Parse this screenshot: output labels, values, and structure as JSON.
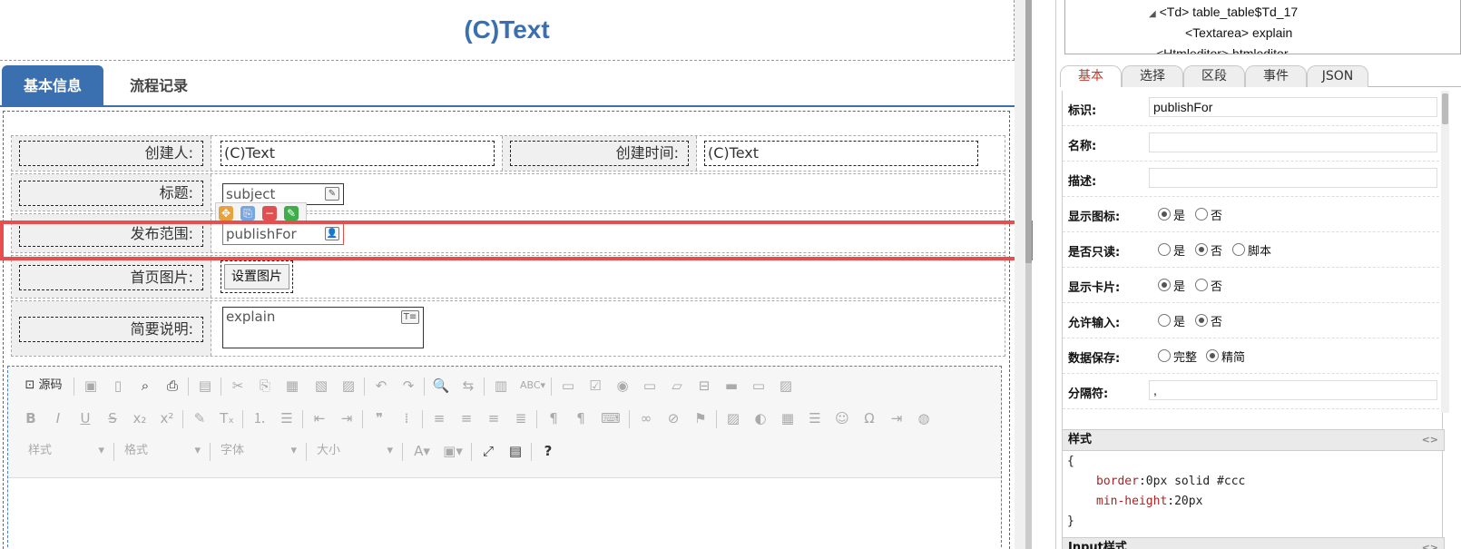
{
  "form": {
    "title": "(C)Text",
    "tabs": [
      {
        "label": "基本信息"
      },
      {
        "label": "流程记录"
      }
    ],
    "fields": {
      "creator_label": "创建人:",
      "creator_value": "(C)Text",
      "created_time_label": "创建时间:",
      "created_time_value": "(C)Text",
      "subject_label": "标题:",
      "subject_value": "subject",
      "publish_label": "发布范围:",
      "publish_value": "publishFor",
      "image_label": "首页图片:",
      "image_button": "设置图片",
      "explain_label": "简要说明:",
      "explain_value": "explain"
    },
    "editor": {
      "source_label": "源码",
      "style_combo": "样式",
      "format_combo": "格式",
      "font_combo": "字体",
      "size_combo": "大小",
      "help": "?"
    }
  },
  "tree": {
    "items": [
      "<Td> table_table$Td_17",
      "<Textarea> explain",
      "<Htmleditor> htmleditor"
    ]
  },
  "props": {
    "tabs": [
      {
        "label": "基本"
      },
      {
        "label": "选择"
      },
      {
        "label": "区段"
      },
      {
        "label": "事件"
      },
      {
        "label": "JSON"
      }
    ],
    "id_label": "标识:",
    "id_value": "publishFor",
    "name_label": "名称:",
    "desc_label": "描述:",
    "show_icon_label": "显示图标:",
    "readonly_label": "是否只读:",
    "show_card_label": "显示卡片:",
    "allow_input_label": "允许输入:",
    "data_save_label": "数据保存:",
    "separator_label": "分隔符:",
    "separator_value": ",",
    "yes": "是",
    "no": "否",
    "script": "脚本",
    "full": "完整",
    "compact": "精简",
    "style_section": "样式",
    "input_style_section": "Input样式",
    "css_open": "{",
    "css_close": "}",
    "css_k1": "border",
    "css_v1": ":0px solid #ccc",
    "css_k2": "min-height",
    "css_v2": ":20px",
    "expand_glyph": "<>"
  },
  "colors": {
    "accent": "#3a6fb0",
    "highlight": "#e84e4e",
    "required_border": "#e84e4e"
  }
}
